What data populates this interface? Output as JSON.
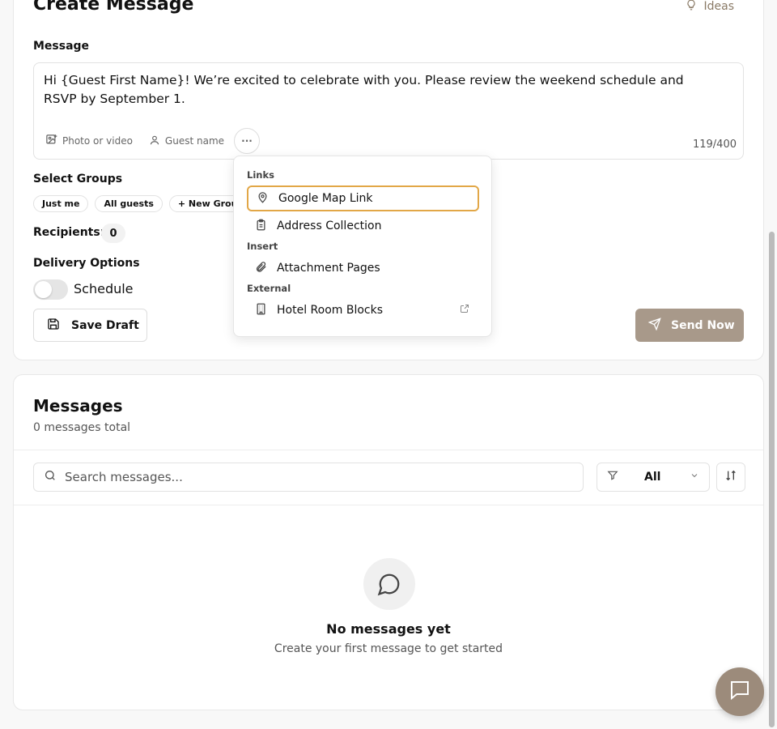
{
  "create": {
    "title": "Create Message",
    "ideas_label": "Ideas",
    "message_label": "Message",
    "message_text": "Hi {Guest First Name}! We’re excited to celebrate with you. Please review the weekend schedule and RSVP by September 1.",
    "tools": {
      "photo_label": "Photo or video",
      "guest_label": "Guest name",
      "more_label": "···"
    },
    "counter": "119/400",
    "select_groups_label": "Select Groups",
    "groups": [
      "Just me",
      "All guests",
      "+ New Group"
    ],
    "recipients_label": "Recipients:",
    "recipients_count": "0",
    "delivery_label": "Delivery Options",
    "schedule_label": "Schedule",
    "save_draft_label": "Save Draft",
    "send_now_label": "Send Now"
  },
  "dropdown": {
    "sections": [
      {
        "title": "Links",
        "items": [
          "Google Map Link",
          "Address Collection"
        ]
      },
      {
        "title": "Insert",
        "items": [
          "Attachment Pages"
        ]
      },
      {
        "title": "External",
        "items": [
          "Hotel Room Blocks"
        ]
      }
    ]
  },
  "messages": {
    "title": "Messages",
    "subtitle": "0 messages total",
    "search_placeholder": "Search messages...",
    "filter_value": "All",
    "empty_title": "No messages yet",
    "empty_subtitle": "Create your first message to get started"
  },
  "colors": {
    "accent": "#a8998a",
    "highlight": "#e2a747",
    "fab": "#9c8b7b"
  },
  "icons": [
    "lightbulb-icon",
    "image-plus-icon",
    "user-icon",
    "map-pin-icon",
    "clipboard-icon",
    "paperclip-icon",
    "building-icon",
    "external-link-icon",
    "save-icon",
    "send-icon",
    "search-icon",
    "filter-icon",
    "chevron-down-icon",
    "sort-icon",
    "message-circle-icon",
    "chat-icon"
  ]
}
